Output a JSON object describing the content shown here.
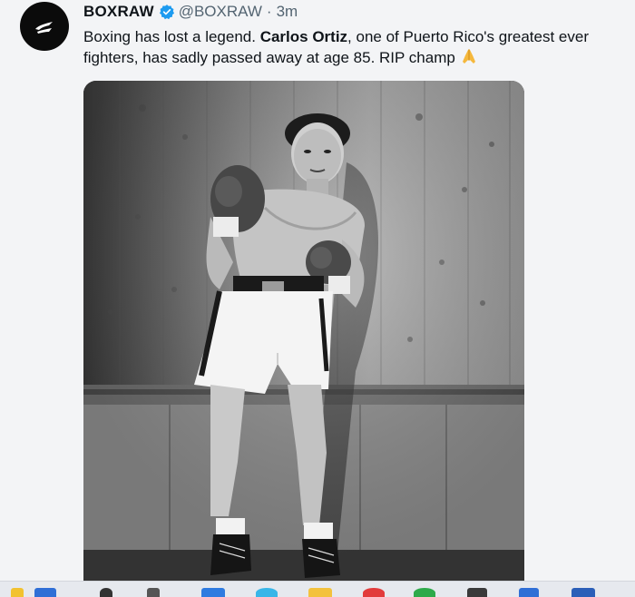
{
  "tweet": {
    "display_name": "BOXRAW",
    "handle": "@BOXRAW",
    "separator": "·",
    "time": "3m",
    "text_part1": "Boxing has lost a legend. ",
    "text_bold": "Carlos Ortiz",
    "text_part2": ", one of Puerto Rico's greatest ever fighters, has sadly passed away at age 85. RIP champ ",
    "emoji": "praying-hands",
    "media_alt": "Black and white photo of a boxer in a fighting stance wearing gloves and white trunks"
  },
  "icons": {
    "avatar": "boxraw-logo-icon",
    "verified": "verified-badge-icon",
    "taskbar": [
      "copilot-icon",
      "calendar-icon",
      "search-icon",
      "file-explorer-icon",
      "store-icon",
      "edge-icon",
      "folder-icon",
      "opera-icon",
      "chrome-icon",
      "app-icon",
      "app-icon",
      "word-icon"
    ]
  },
  "colors": {
    "verified": "#1d9bf0",
    "text": "#0f1419",
    "muted": "#536471"
  }
}
